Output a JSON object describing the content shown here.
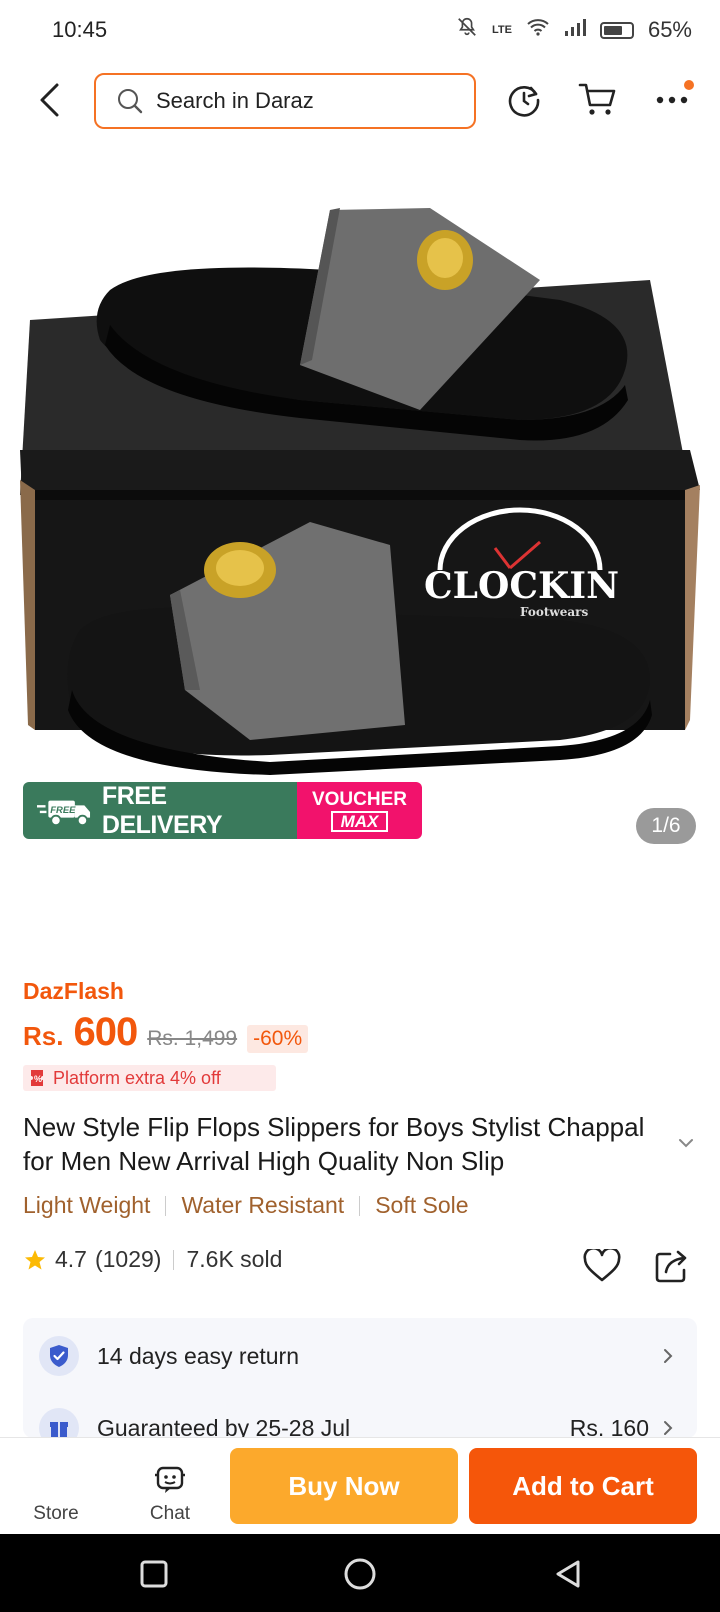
{
  "status": {
    "time": "10:45",
    "network_label": "LTE",
    "battery_pct": "65%"
  },
  "header": {
    "search_placeholder": "Search in Daraz"
  },
  "gallery": {
    "brand_logo": "CLOCKIN",
    "brand_sub": "Footwears",
    "counter": "1/6"
  },
  "promo": {
    "free_badge": "FREE",
    "free_delivery": "FREE DELIVERY",
    "voucher_top": "VOUCHER",
    "voucher_bottom": "MAX"
  },
  "product": {
    "flash_label": "DazFlash",
    "currency": "Rs.",
    "price": "600",
    "old_price": "Rs. 1,499",
    "discount": "-60%",
    "platform_offer": "Platform extra 4% off",
    "title": "New Style Flip Flops Slippers for Boys Stylist Chappal for Men New Arrival High Quality Non Slip",
    "tags": [
      "Light Weight",
      "Water Resistant",
      "Soft Sole"
    ],
    "rating": "4.7",
    "reviews": "(1029)",
    "sold": "7.6K sold"
  },
  "services": {
    "return_text": "14 days easy return",
    "delivery_text": "Guaranteed by 25-28 Jul",
    "delivery_fee": "Rs. 160"
  },
  "bottom_bar": {
    "store_label": "Store",
    "chat_label": "Chat",
    "buy_now": "Buy Now",
    "add_to_cart": "Add to Cart"
  },
  "colors": {
    "accent_orange": "#f5560a",
    "buy_now_yellow": "#fca92c",
    "free_delivery_green": "#3a7a5c",
    "voucher_pink": "#f2126c",
    "tag_brown": "#a0612d"
  }
}
